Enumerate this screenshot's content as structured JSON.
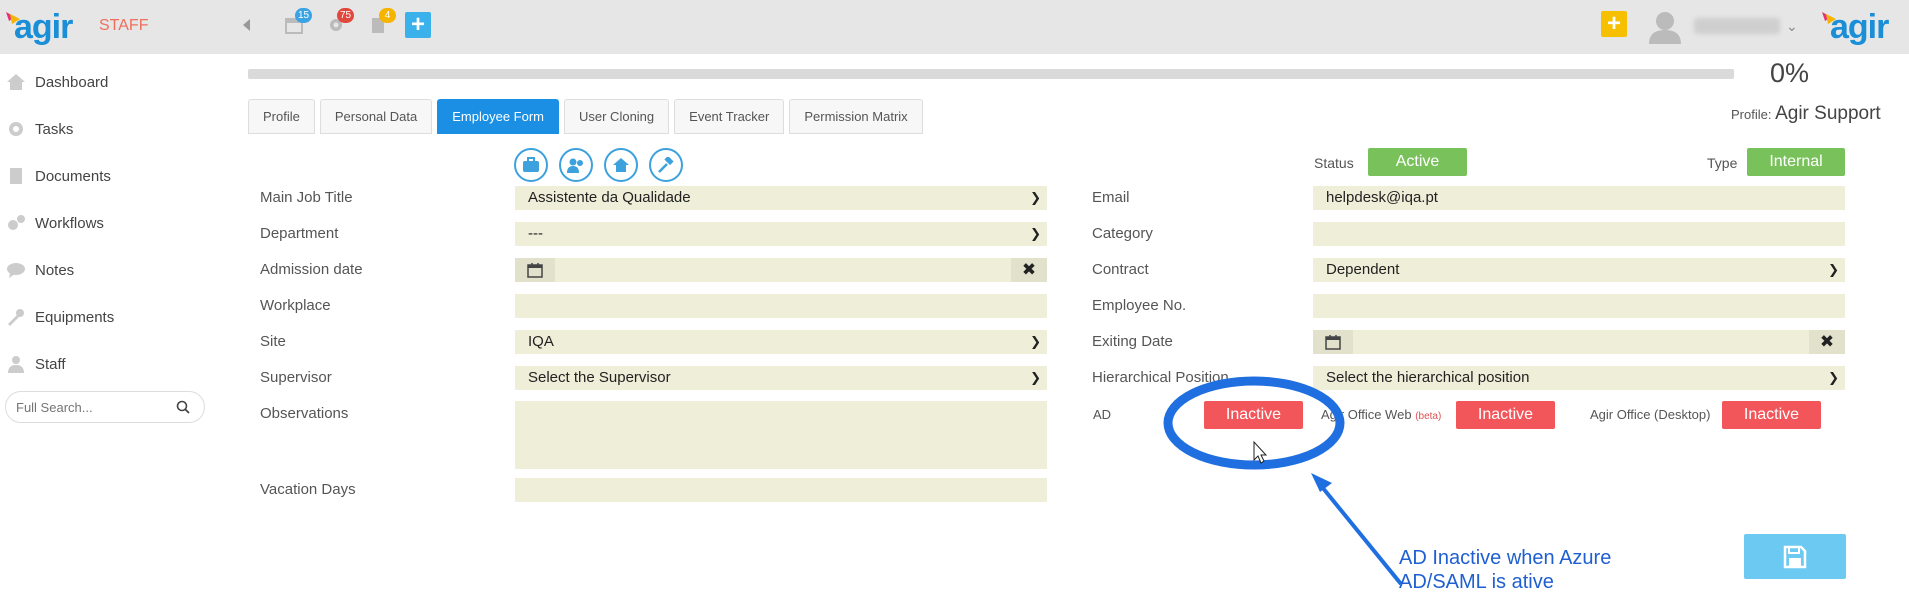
{
  "header": {
    "logo_left": "agir",
    "staff_label": "STAFF",
    "calendar_badge": "15",
    "alerts_badge": "75",
    "docs_badge": "4",
    "logo_right": "agir",
    "colors": {
      "calendar_badge": "#3aa3e3",
      "alerts_badge": "#e0473d",
      "docs_badge": "#f5b400"
    }
  },
  "sidebar": {
    "items": [
      {
        "label": "Dashboard",
        "icon": "home-icon"
      },
      {
        "label": "Tasks",
        "icon": "gear-icon"
      },
      {
        "label": "Documents",
        "icon": "document-icon"
      },
      {
        "label": "Workflows",
        "icon": "cogs-icon"
      },
      {
        "label": "Notes",
        "icon": "chat-icon"
      },
      {
        "label": "Equipments",
        "icon": "wrench-icon"
      },
      {
        "label": "Staff",
        "icon": "user-icon"
      }
    ],
    "search_placeholder": "Full Search..."
  },
  "progress": {
    "value": 0,
    "label": "0%"
  },
  "profile": {
    "label": "Profile:",
    "value": "Agir Support"
  },
  "tabs": [
    {
      "label": "Profile"
    },
    {
      "label": "Personal Data"
    },
    {
      "label": "Employee Form",
      "active": true
    },
    {
      "label": "User Cloning"
    },
    {
      "label": "Event Tracker"
    },
    {
      "label": "Permission Matrix"
    }
  ],
  "form_left": {
    "main_job_title": {
      "label": "Main Job Title",
      "value": "Assistente da Qualidade"
    },
    "department": {
      "label": "Department",
      "value": "---"
    },
    "admission_date": {
      "label": "Admission date",
      "value": ""
    },
    "workplace": {
      "label": "Workplace",
      "value": ""
    },
    "site": {
      "label": "Site",
      "value": "IQA"
    },
    "supervisor": {
      "label": "Supervisor",
      "value": "Select the Supervisor"
    },
    "observations": {
      "label": "Observations",
      "value": ""
    },
    "vacation_days": {
      "label": "Vacation Days",
      "value": ""
    }
  },
  "form_right": {
    "status": {
      "label": "Status",
      "value": "Active"
    },
    "type": {
      "label": "Type",
      "value": "Internal"
    },
    "email": {
      "label": "Email",
      "value": "helpdesk@iqa.pt"
    },
    "category": {
      "label": "Category",
      "value": ""
    },
    "contract": {
      "label": "Contract",
      "value": "Dependent"
    },
    "employee_no": {
      "label": "Employee No.",
      "value": ""
    },
    "exiting_date": {
      "label": "Exiting Date",
      "value": ""
    },
    "hierarchical_position": {
      "label": "Hierarchical Position",
      "value": "Select the hierarchical position"
    },
    "ad": {
      "label": "AD",
      "value": "Inactive"
    },
    "office_web": {
      "label": "Agir Office Web",
      "beta": "(beta)",
      "value": "Inactive"
    },
    "office_desktop": {
      "label": "Agir Office (Desktop)",
      "value": "Inactive"
    }
  },
  "annotation": {
    "line1": "AD Inactive when Azure",
    "line2": "AD/SAML is ative",
    "color": "#1f6fe0"
  }
}
